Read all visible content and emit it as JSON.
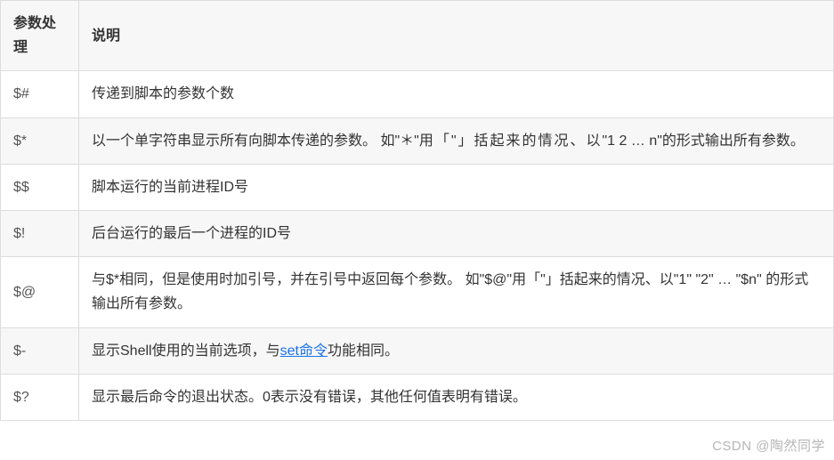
{
  "table": {
    "headers": {
      "param": "参数处理",
      "desc": "说明"
    },
    "rows": [
      {
        "param": "$#",
        "desc": "传递到脚本的参数个数"
      },
      {
        "param": "$*",
        "desc_pre": "以一个单字符串显示所有向脚本传递的参数。 如\"＊\"",
        "desc_spaced": "用「\"」括起来的情况、以",
        "desc_post": "\"1 2 … n\"的形式输出所有参数。"
      },
      {
        "param": "$$",
        "desc": "脚本运行的当前进程ID号"
      },
      {
        "param": "$!",
        "desc": "后台运行的最后一个进程的ID号"
      },
      {
        "param": "$@",
        "desc": "与$*相同，但是使用时加引号，并在引号中返回每个参数。 如\"$@\"用「\"」括起来的情况、以\"1\" \"2\" … \"$n\" 的形式输出所有参数。"
      },
      {
        "param": "$-",
        "desc_pre": "显示Shell使用的当前选项，与",
        "link_text": "set命令",
        "desc_post": "功能相同。"
      },
      {
        "param": "$?",
        "desc": "显示最后命令的退出状态。0表示没有错误，其他任何值表明有错误。"
      }
    ]
  },
  "watermark": "CSDN @陶然同学"
}
